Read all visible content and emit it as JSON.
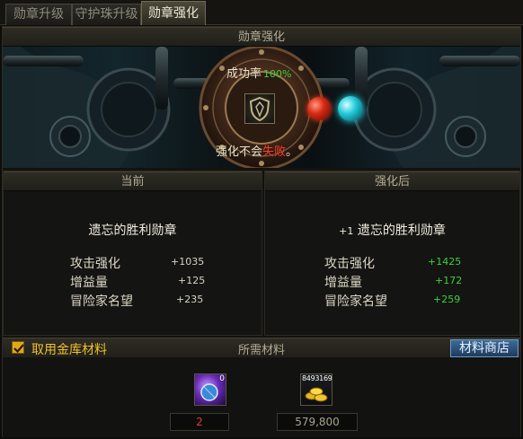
{
  "tabs": [
    {
      "label": "勋章升级",
      "active": false
    },
    {
      "label": "守护珠升级",
      "active": false
    },
    {
      "label": "勋章强化",
      "active": true
    }
  ],
  "header": {
    "title": "勋章强化"
  },
  "machine": {
    "success_label": "成功率",
    "success_rate": "100%",
    "fail_text_prefix": "强化不会",
    "fail_word": "失败",
    "fail_text_suffix": "。"
  },
  "current": {
    "title": "当前",
    "item_name": "遗忘的胜利勋章",
    "stats": [
      {
        "label": "攻击强化",
        "value": "+1035"
      },
      {
        "label": "增益量",
        "value": "+125"
      },
      {
        "label": "冒险家名望",
        "value": "+235"
      }
    ]
  },
  "after": {
    "title": "强化后",
    "level_prefix": "+1",
    "item_name": "遗忘的胜利勋章",
    "stats": [
      {
        "label": "攻击强化",
        "value": "+1425"
      },
      {
        "label": "增益量",
        "value": "+172"
      },
      {
        "label": "冒险家名望",
        "value": "+259"
      }
    ]
  },
  "materials": {
    "use_gold_label": "取用金库材料",
    "use_gold_checked": true,
    "title": "所需材料",
    "shop_button": "材料商店",
    "items": [
      {
        "icon": "medal-stone-icon",
        "badge": "0",
        "count": "2",
        "count_color": "#e8392b"
      },
      {
        "icon": "gold-coin-icon",
        "badge": "8493169",
        "count": "579,800",
        "count_color": "#a8a390"
      }
    ]
  },
  "colors": {
    "positive": "#3cd23c",
    "fail_red": "#ff3a2a",
    "gold_text": "#f0c228",
    "shop_blue": "#2b5580"
  }
}
